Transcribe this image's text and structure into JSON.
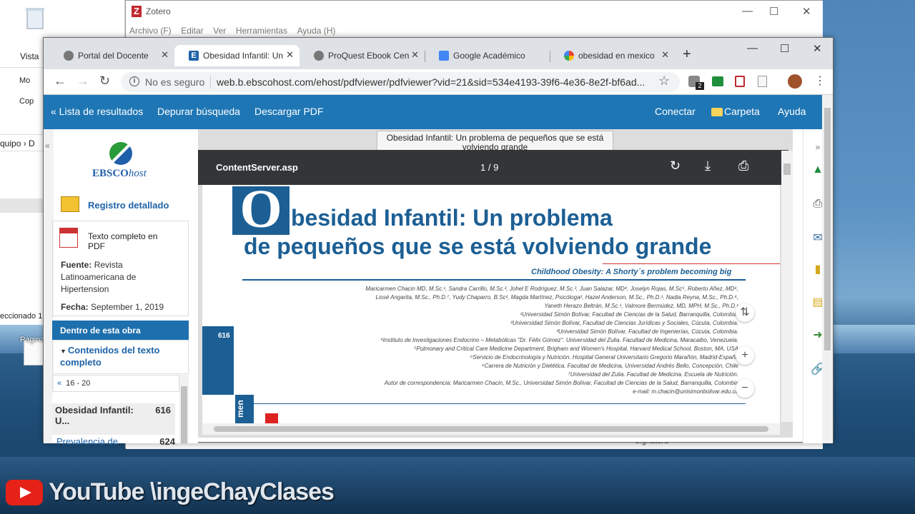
{
  "desktop": {
    "explorer": {
      "view_label": "Vista",
      "item_mo": "Mo",
      "item_co": "Cop",
      "address": "quipo  ›  D",
      "status": "eccionado  1",
      "desktop_icon": "Pagina"
    },
    "watermark": "YouTube \\ingeChayClases"
  },
  "zotero": {
    "title": "Zotero",
    "menu": [
      "Archivo (F)",
      "Editar",
      "Ver",
      "Herramientas",
      "Ayuda (H)"
    ],
    "footer_text": "Signatura"
  },
  "chrome": {
    "tabs": [
      {
        "label": "Portal del Docente",
        "icon": "globe-icon",
        "active": false
      },
      {
        "label": "Obesidad Infantil: Un",
        "icon": "ebsco-icon",
        "active": true
      },
      {
        "label": "ProQuest Ebook Cen",
        "icon": "globe-icon",
        "active": false
      },
      {
        "label": "Google Académico",
        "icon": "scholar-icon",
        "active": false
      },
      {
        "label": "obesidad en mexico",
        "icon": "google-icon",
        "active": false
      }
    ],
    "address": {
      "security": "No es seguro",
      "url": "web.b.ebscohost.com/ehost/pdfviewer/pdfviewer?vid=21&sid=534e4193-39f6-4e36-8e2f-bf6ad..."
    },
    "extension_badge": "2"
  },
  "ebsco": {
    "topnav": {
      "back": "« Lista de resultados",
      "refine": "Depurar búsqueda",
      "download": "Descargar PDF",
      "login": "Conectar",
      "folder": "Carpeta",
      "help": "Ayuda"
    },
    "logo": {
      "brand": "EBSCO",
      "suffix": "host"
    },
    "left": {
      "detailed_record": "Registro detallado",
      "full_text": "Texto completo en PDF",
      "source_label": "Fuente:",
      "source_value": "Revista Latinoamericana de Hipertension",
      "date_label": "Fecha:",
      "date_value": "September 1, 2019",
      "within_work": "Dentro de esta obra",
      "contents": "Contenidos del texto completo",
      "pager": "16 - 20",
      "toc": [
        {
          "title": "Obesidad Infantil: U...",
          "page": "616"
        },
        {
          "title": "Prevalencia de",
          "page": "624"
        }
      ]
    },
    "pdf": {
      "doc_title": "Obesidad Infantil: Un problema de pequeños que se está volviendo grande",
      "file_name": "ContentServer.asp",
      "page_counter": "1 / 9",
      "drop_letter": "O",
      "title_line1": "besidad Infantil: Un problema",
      "title_line2": "de pequeños que se está volviendo grande",
      "english_title": "Childhood Obesity: A Shorty´s problem becoming big",
      "authors": [
        "Maricarmen Chacin MD, M.Sc.¹, Sandra Carrillo, M.Sc.², Johel E Rodríguez, M.Sc.³, Juan Salazar, MD⁴, Joselyn Rojas, M.Sc⁵, Roberto Añez, MD⁶,",
        "Lissé Angarita, M.Sc., Ph.D.⁷, Yudy Chaparro, B.Sc², Magda Martínez, Psicóloga², Hazel Anderson, M.Sc., Ph.D.¹, Nadia Reyna, M.Sc., Ph.D.⁴,",
        "Yaneth Herazo Beltrán, M.Sc.¹, Valmore Bermúdez, MD, MPH, M.Sc., Ph.D.¹",
        "¹Universidad Simón Bolívar, Facultad de Ciencias de la Salud, Barranquilla, Colombia.",
        "²Universidad Simón Bolívar, Facultad de Ciencias Jurídicas y Sociales, Cúcuta, Colombia.",
        "³Universidad Simón Bolívar, Facultad de Ingenierías, Cúcuta, Colombia.",
        "⁴Instituto de Investigaciones Endocrino – Metabólicas \"Dr. Félix Gómez\". Universidad del Zulia. Facultad de Medicina, Maracaibo, Venezuela.",
        "⁵Pulmonary and Critical Care Medicine Department, Brigham and Women's Hospital, Harvard Medical School, Boston, MA, USA",
        "⁶Servicio de Endocrinología y Nutrición. Hospital General Universitario Gregorio Marañón, Madrid-España",
        "⁶Carrera de Nutrición y Dietética, Facultad de Medicina, Universidad Andrés Bello, Concepción, Chile",
        "⁷Universidad del Zulia. Facultad de Medicina. Escuela de Nutrición.",
        "Autor de correspondencia: Maricarmen Chacin, M.Sc., Universidad Simón Bolívar, Facultad de Ciencias de la Salud, Barranquilla, Colombia",
        "e-mail: m.chacin@unisimonbolivar.edu.co"
      ],
      "page_number": "616",
      "section_tab": "men"
    }
  },
  "colors": {
    "ebsco_blue": "#1e76b4",
    "title_blue": "#1c5f94",
    "pdf_toolbar": "#323639"
  }
}
